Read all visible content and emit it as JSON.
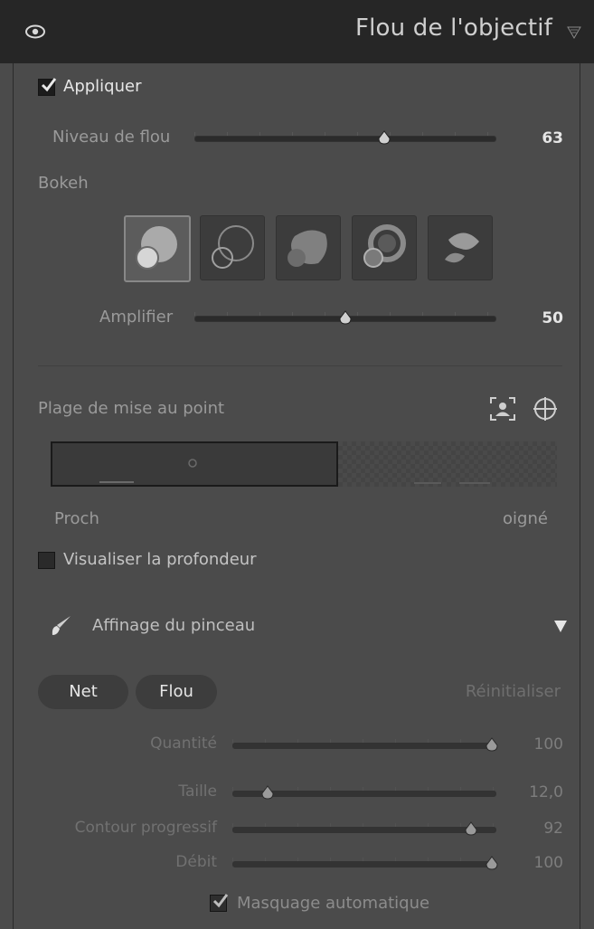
{
  "header": {
    "title": "Flou de l'objectif",
    "eye_icon": "eye-icon",
    "menu_icon": "triangle-down-icon"
  },
  "apply": {
    "label": "Appliquer",
    "checked": true
  },
  "blur": {
    "label": "Niveau de flou",
    "value": "63",
    "fraction": 0.63
  },
  "bokeh": {
    "label": "Bokeh",
    "selected": 0,
    "shapes": [
      "bokeh-circle-icon",
      "bokeh-rings-icon",
      "bokeh-blob-icon",
      "bokeh-ring-icon",
      "bokeh-leaf-icon"
    ]
  },
  "amplify": {
    "label": "Amplifier",
    "value": "50",
    "fraction": 0.5
  },
  "focus": {
    "label": "Plage de mise au point",
    "near_label": "Proch",
    "far_label": "oigné",
    "icons": [
      "subject-focus-icon",
      "crosshair-target-icon"
    ]
  },
  "visualize": {
    "label": "Visualiser la profondeur",
    "checked": false
  },
  "refine": {
    "title": "Affinage du pinceau",
    "icon": "brush-icon",
    "collapse_icon": "triangle-down-icon"
  },
  "brush_tabs": {
    "net": "Net",
    "flou": "Flou",
    "reset": "Réinitialiser"
  },
  "brush": [
    {
      "label": "Quantité",
      "value": "100",
      "fraction": 1.0
    },
    {
      "label": "Taille",
      "value": "12,0",
      "fraction": 0.12
    },
    {
      "label": "Contour progressif",
      "value": "92",
      "fraction": 0.92
    },
    {
      "label": "Débit",
      "value": "100",
      "fraction": 1.0
    }
  ],
  "automask": {
    "label": "Masquage automatique",
    "checked": true
  },
  "colors": {
    "header_bg": "#262626",
    "panel_bg": "#4b4b4b",
    "track": "#2b2b2b"
  }
}
